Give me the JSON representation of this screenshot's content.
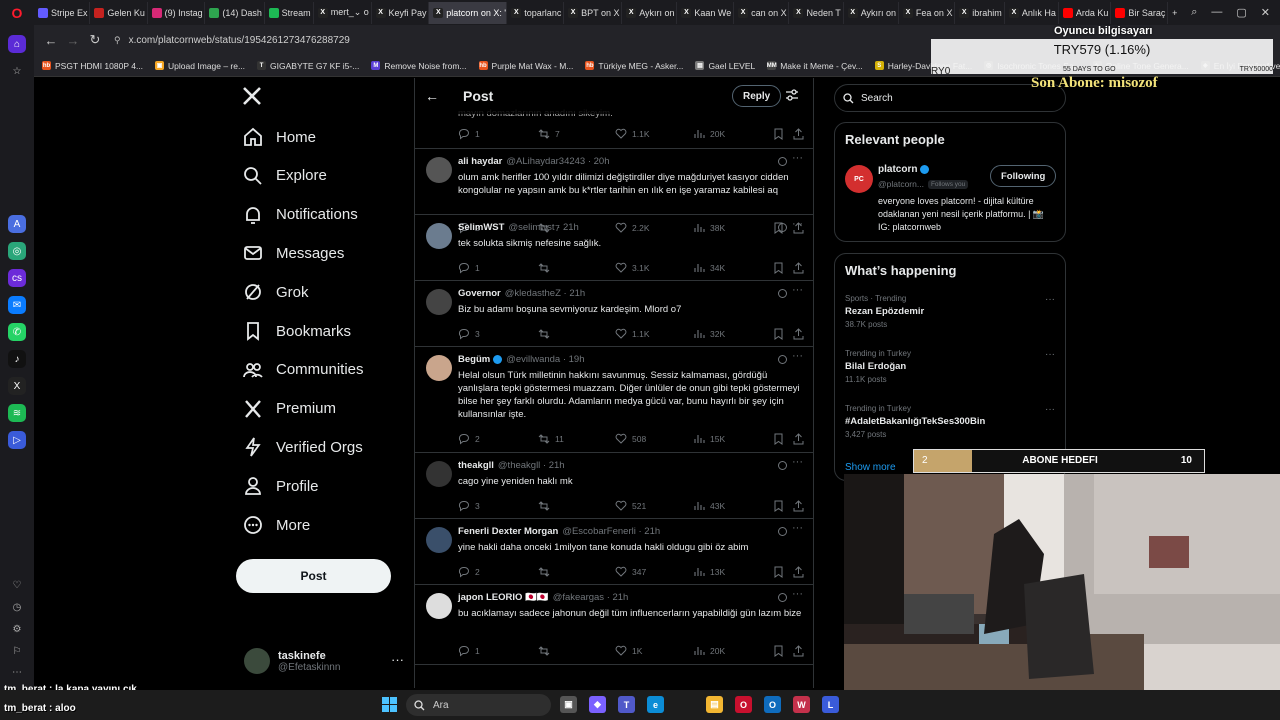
{
  "browser": {
    "tabs": [
      {
        "label": "Stripe Ex",
        "icon": "stripe-icon",
        "color": "#635bff"
      },
      {
        "label": "Gelen Ku",
        "icon": "gmail-icon",
        "color": "#c5221f"
      },
      {
        "label": "(9) Instag",
        "icon": "instagram-icon",
        "color": "#d62976"
      },
      {
        "label": "(14) Dash",
        "icon": "dashboard-icon",
        "color": "#2ea44f"
      },
      {
        "label": "Stream",
        "icon": "stream-icon",
        "color": "#1db954"
      },
      {
        "label": "mert_⌄ o",
        "icon": "x-icon",
        "color": "#222222"
      },
      {
        "label": "Keyfi Pay",
        "icon": "x-icon",
        "color": "#222222"
      },
      {
        "label": "platcorn on X: \"",
        "icon": "x-icon",
        "color": "#222222",
        "active": true
      },
      {
        "label": "toparlanc",
        "icon": "x-icon",
        "color": "#222222"
      },
      {
        "label": "BPT on X",
        "icon": "x-icon",
        "color": "#222222"
      },
      {
        "label": "Aykırı on",
        "icon": "x-icon",
        "color": "#222222"
      },
      {
        "label": "Kaan We",
        "icon": "x-icon",
        "color": "#222222"
      },
      {
        "label": "can on X",
        "icon": "x-icon",
        "color": "#222222"
      },
      {
        "label": "Neden T",
        "icon": "x-icon",
        "color": "#222222"
      },
      {
        "label": "Aykırı on",
        "icon": "x-icon",
        "color": "#222222"
      },
      {
        "label": "Fea on X",
        "icon": "x-icon",
        "color": "#222222"
      },
      {
        "label": "ibrahim",
        "icon": "x-icon",
        "color": "#222222"
      },
      {
        "label": "Anlık Ha",
        "icon": "x-icon",
        "color": "#222222"
      },
      {
        "label": "Arda Ku",
        "icon": "youtube-icon",
        "color": "#ff0000"
      },
      {
        "label": "Bir Saraç",
        "icon": "youtube-icon",
        "color": "#ff0000"
      }
    ],
    "url": "x.com/platcornweb/status/1954261273476288729",
    "bookmarks": [
      {
        "label": "PSGT HDMI 1080P 4...",
        "color": "#e8541e",
        "glyph": "hb"
      },
      {
        "label": "Upload Image – re...",
        "color": "#f5a623",
        "glyph": "▣"
      },
      {
        "label": "GIGABYTE G7 KF i5-...",
        "color": "#333333",
        "glyph": "T"
      },
      {
        "label": "Remove Noise from...",
        "color": "#5b3fd6",
        "glyph": "M"
      },
      {
        "label": "Purple Mat Wax - M...",
        "color": "#e8541e",
        "glyph": "hb"
      },
      {
        "label": "Türkiye MEG - Asker...",
        "color": "#e8541e",
        "glyph": "hb"
      },
      {
        "label": "Gael LEVEL",
        "color": "#7a7a7a",
        "glyph": "▤"
      },
      {
        "label": "Make it Meme - Çev...",
        "color": "#444444",
        "glyph": "MM"
      },
      {
        "label": "Harley-Davidson Fat...",
        "color": "#d4b106",
        "glyph": "S"
      },
      {
        "label": "Isochronic Tones So...",
        "color": "#555555",
        "glyph": "◎"
      },
      {
        "label": "Online Tone Genera...",
        "color": "#555555",
        "glyph": "∿"
      },
      {
        "label": "En İyi Fotoğraf ve Vi...",
        "color": "#555555",
        "glyph": "◈"
      }
    ]
  },
  "x": {
    "nav": [
      {
        "label": "Home",
        "icon": "home-icon"
      },
      {
        "label": "Explore",
        "icon": "search-icon"
      },
      {
        "label": "Notifications",
        "icon": "bell-icon"
      },
      {
        "label": "Messages",
        "icon": "envelope-icon"
      },
      {
        "label": "Grok",
        "icon": "grok-icon"
      },
      {
        "label": "Bookmarks",
        "icon": "bookmark-icon"
      },
      {
        "label": "Communities",
        "icon": "people-icon"
      },
      {
        "label": "Premium",
        "icon": "x-logo-icon"
      },
      {
        "label": "Verified Orgs",
        "icon": "lightning-icon"
      },
      {
        "label": "Profile",
        "icon": "person-icon"
      },
      {
        "label": "More",
        "icon": "more-circle-icon"
      }
    ],
    "post_button": "Post",
    "account": {
      "name": "taskinefe",
      "handle": "@Efetaskinnn"
    },
    "header": {
      "title": "Post",
      "reply_button": "Reply"
    },
    "top_partial": {
      "text": "mayın domazlarının anadını sikeyim.",
      "replies": "1",
      "reposts": "7",
      "likes": "1.1K",
      "views": "20K"
    },
    "tweets": [
      {
        "name": "ali haydar",
        "handle": "@ALihaydar34243 · 20h",
        "verified": false,
        "text": "olum amk herifler 100 yıldır dilimizi değiştirdiler diye mağduriyet kasıyor cidden kongolular ne yapsın amk bu k*rtler tarihin en ılık en işe yaramaz kabilesi aq",
        "replies": "2",
        "reposts": "7",
        "likes": "2.2K",
        "views": "38K",
        "avatar": "#555555"
      },
      {
        "name": "SelimWST",
        "handle": "@selimwst · 21h",
        "verified": false,
        "text": "tek solukta sikmiş nefesine sağlık.",
        "replies": "1",
        "reposts": "",
        "likes": "3.1K",
        "views": "34K",
        "avatar": "#6b7c8f"
      },
      {
        "name": "Governor",
        "handle": "@kledastheZ · 21h",
        "verified": false,
        "text": "Biz bu adamı boşuna sevmiyoruz kardeşim. Mlord o7",
        "replies": "3",
        "reposts": "",
        "likes": "1.1K",
        "views": "32K",
        "avatar": "#444444"
      },
      {
        "name": "Begüm",
        "handle": "@evillwanda · 19h",
        "verified": true,
        "text": "Helal olsun Türk milletinin hakkını savunmuş. Sessiz kalmaması, gördüğü yanlışlara tepki göstermesi muazzam. Diğer ünlüler de onun gibi tepki göstermeyi bilse her şey farklı olurdu. Adamların medya gücü var, bunu hayırlı bir şey için kullansınlar işte.",
        "replies": "2",
        "reposts": "11",
        "likes": "508",
        "views": "15K",
        "avatar": "#c9a58c"
      },
      {
        "name": "theakgll",
        "handle": "@theakgll · 21h",
        "verified": false,
        "text": "cago yine yeniden haklı mk",
        "replies": "3",
        "reposts": "",
        "likes": "521",
        "views": "43K",
        "avatar": "#333333"
      },
      {
        "name": "Fenerli Dexter Morgan",
        "handle": "@EscobarFenerli · 21h",
        "verified": false,
        "text": "yine hakli daha onceki 1milyon tane konuda hakli oldugu gibi öz abim",
        "replies": "2",
        "reposts": "",
        "likes": "347",
        "views": "13K",
        "avatar": "#3a4f6a"
      },
      {
        "name": "japon LEORIO 🇯🇵🇯🇵",
        "handle": "@fakeargas · 21h",
        "verified": false,
        "text": "bu acıklamayı sadece jahonun değil tüm influencerların yapabildiği gün lazım bize",
        "replies": "1",
        "reposts": "",
        "likes": "1K",
        "views": "20K",
        "avatar": "#dddddd"
      }
    ],
    "right": {
      "search_placeholder": "Search",
      "relevant_title": "Relevant people",
      "person": {
        "name": "platcorn",
        "handle": "@platcorn...",
        "follows_you": "Follows you",
        "follow_label": "Following",
        "bio": "everyone loves platcorn! - dijital kültüre odaklanan yeni nesil içerik platformu. | 📸 IG: platcornweb"
      },
      "happening_title": "What’s happening",
      "trends": [
        {
          "meta": "Sports · Trending",
          "name": "Rezan Epözdemir",
          "posts": "38.7K posts"
        },
        {
          "meta": "Trending in Turkey",
          "name": "Bilal Erdoğan",
          "posts": "11.1K posts"
        },
        {
          "meta": "Trending in Turkey",
          "name": "#AdaletBakanlığıTekSes300Bin",
          "posts": "3,427 posts"
        }
      ],
      "show_more": "Show more"
    }
  },
  "stream": {
    "title": "Oyuncu bilgisayarı",
    "price": "TRY579 (1.16%)",
    "left_small": "RY0",
    "center_small": "55 DAYS TO GO",
    "right_small": "TRY50000",
    "sub_text": "Son Abone: misozof",
    "goal": {
      "label": "ABONE HEDEFI",
      "current": "2",
      "target": "10",
      "progress": 0.2
    },
    "chat": [
      {
        "user": "tm_berat",
        "text": "la kapa yayını çık"
      },
      {
        "user": "tm_berat",
        "text": "aloo"
      }
    ]
  },
  "taskbar": {
    "search_placeholder": "Ara"
  }
}
